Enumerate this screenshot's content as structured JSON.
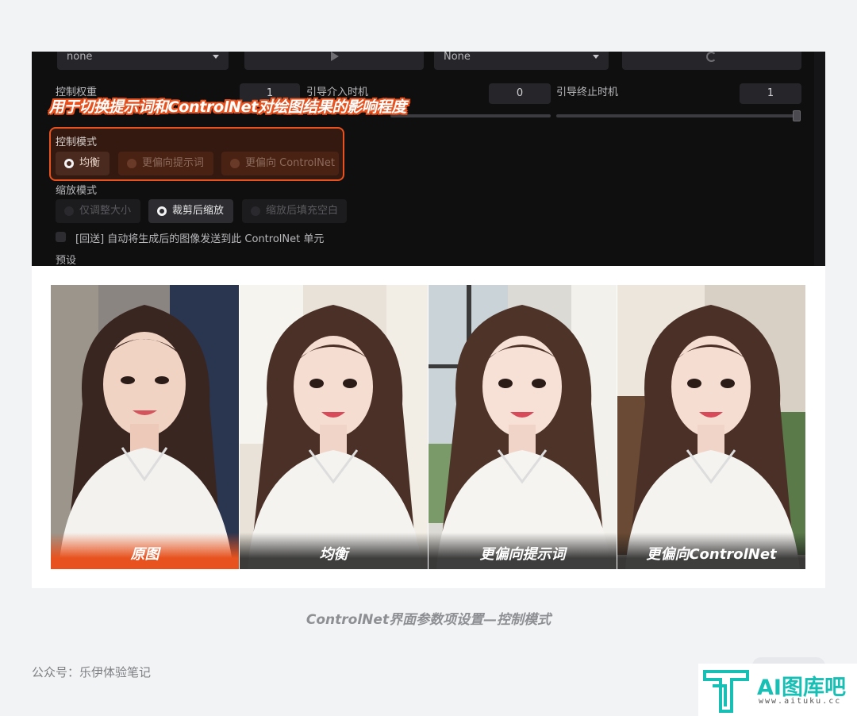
{
  "panel": {
    "dropdown_left": "none",
    "dropdown_right": "None",
    "control_weight_label": "控制权重",
    "control_weight_value": "1",
    "guidance_start_label": "引导介入时机",
    "guidance_start_value": "0",
    "guidance_end_label": "引导终止时机",
    "guidance_end_value": "1",
    "callout": "用于切换提示词和ControlNet对绘图结果的影响程度",
    "control_mode_label": "控制模式",
    "control_mode_options": [
      "均衡",
      "更偏向提示词",
      "更偏向 ControlNet"
    ],
    "control_mode_selected": "均衡",
    "resize_mode_label": "缩放模式",
    "resize_mode_options": [
      "仅调整大小",
      "裁剪后缩放",
      "缩放后填充空白"
    ],
    "resize_mode_selected": "裁剪后缩放",
    "loopback_label": "[回送] 自动将生成后的图像发送到此 ControlNet 单元",
    "preset_label": "预设"
  },
  "photos": [
    {
      "caption": "原图"
    },
    {
      "caption": "均衡"
    },
    {
      "caption": "更偏向提示词"
    },
    {
      "caption": "更偏向ControlNet"
    }
  ],
  "figure_caption": "ControlNet界面参数项设置—控制模式",
  "account": "公众号：乐伊体验笔记",
  "logo": {
    "name": "AI图库吧",
    "url": "www.aituku.cc"
  },
  "colors": {
    "accent": "#e8521e",
    "logo": "#17bfb5",
    "panel_bg": "#0f0f10"
  }
}
